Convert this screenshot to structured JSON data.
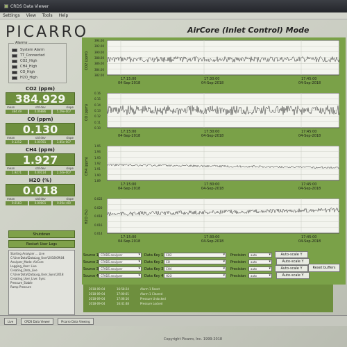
{
  "window": {
    "title": "CRDS Data Viewer"
  },
  "menu": [
    "Settings",
    "View",
    "Tools",
    "Help"
  ],
  "brand": "PICARRO",
  "mode_title": "AirCore (Inlet Control) Mode",
  "alarms": {
    "label": "Alarms",
    "items": [
      "System Alarm",
      "TT_Connected",
      "CO2_High",
      "CH4_High",
      "CO_High",
      "H2O_High"
    ]
  },
  "readouts": [
    {
      "label": "CO2 (ppm)",
      "value": "384.929",
      "stats": [
        "mean",
        "std dev",
        "slope"
      ],
      "statvals": [
        "384.49",
        "0.06886",
        "5.29e-007"
      ]
    },
    {
      "label": "CO (ppm)",
      "value": "0.130",
      "stats": [
        "mean",
        "std dev",
        "slope"
      ],
      "statvals": [
        "0.1252",
        "0.00781",
        "3.85e-007"
      ]
    },
    {
      "label": "CH4 (ppm)",
      "value": "1.927",
      "stats": [
        "mean",
        "std dev",
        "slope"
      ],
      "statvals": [
        "1.9271",
        "0.00114",
        "2.24e-007"
      ]
    },
    {
      "label": "H2O (%)",
      "value": "0.018",
      "stats": [
        "mean",
        "std dev",
        "slope"
      ],
      "statvals": [
        "0.0183",
        "0.00001",
        "0.00e+00"
      ]
    }
  ],
  "buttons": {
    "shutdown": "Shutdown",
    "restart": "Restart User Logs",
    "reset": "Reset buffers",
    "autoscale": "Auto-scale Y"
  },
  "log_lines": [
    "Starting Analyzer ... Live",
    "C:\\UserData\\DataLog_User\\2018\\09\\04",
    "Analyzer_Mode: AirCore",
    "Logging_User: Live",
    "Creating_Data_Live",
    "C:\\UserData\\DataLog_User_Sync\\2018",
    "Creating_User_Live: Sync",
    "Pressure_Stable",
    "Ramp Pressure"
  ],
  "plots": [
    {
      "ylabel": "CO2 (ppm)",
      "yticks": [
        "394.00",
        "392.00",
        "390.00",
        "388.00",
        "386.00",
        "384.00",
        "382.00"
      ],
      "xticks": [
        {
          "t": "17:15:00",
          "d": "04-Sep-2018"
        },
        {
          "t": "17:30:00",
          "d": "04-Sep-2018"
        },
        {
          "t": "17:45:00",
          "d": "04-Sep-2018"
        }
      ]
    },
    {
      "ylabel": "CO (ppm)",
      "yticks": [
        "0.16",
        "0.15",
        "0.14",
        "0.13",
        "0.12",
        "0.11",
        "0.10"
      ],
      "xticks": [
        {
          "t": "17:15:00",
          "d": "04-Sep-2018"
        },
        {
          "t": "17:30:00",
          "d": "04-Sep-2018"
        },
        {
          "t": "17:45:00",
          "d": "04-Sep-2018"
        }
      ]
    },
    {
      "ylabel": "CH4 (ppm)",
      "yticks": [
        "1.95",
        "1.94",
        "1.93",
        "1.92",
        "1.91",
        "1.90",
        "1.89"
      ],
      "xticks": [
        {
          "t": "17:15:00",
          "d": "04-Sep-2018"
        },
        {
          "t": "17:30:00",
          "d": "04-Sep-2018"
        },
        {
          "t": "17:45:00",
          "d": "04-Sep-2018"
        }
      ]
    },
    {
      "ylabel": "H2O (%)",
      "yticks": [
        "0.022",
        "0.020",
        "0.018",
        "0.016",
        "0.014"
      ],
      "xticks": [
        {
          "t": "17:15:00",
          "d": "04-Sep-2018"
        },
        {
          "t": "17:30:00",
          "d": "04-Sep-2018"
        },
        {
          "t": "17:45:00",
          "d": "04-Sep-2018"
        }
      ]
    }
  ],
  "controls": [
    {
      "source": "Source 1",
      "analyzer": "CFADS analyzer",
      "datakey": "Data Key 1",
      "key": "CO2",
      "precision": "Precision",
      "prec": "auto"
    },
    {
      "source": "Source 2",
      "analyzer": "CFADS analyzer",
      "datakey": "Data Key 2",
      "key": "CO",
      "precision": "Precision",
      "prec": "auto"
    },
    {
      "source": "Source 3",
      "analyzer": "CFADS analyzer",
      "datakey": "Data Key 3",
      "key": "CH4",
      "precision": "Precision",
      "prec": "auto"
    },
    {
      "source": "Source 4",
      "analyzer": "CFADS analyzer",
      "datakey": "Data Key 4",
      "key": "H2O",
      "precision": "Precision",
      "prec": "auto"
    }
  ],
  "events": [
    {
      "date": "2018-09-04",
      "time": "16:58:24",
      "msg": "Alarm 1 Reset"
    },
    {
      "date": "2018-09-04",
      "time": "17:00:01",
      "msg": "Alarm 1 Cleared"
    },
    {
      "date": "2018-09-04",
      "time": "17:06:16",
      "msg": "Pressure Unlocked"
    },
    {
      "date": "2018-09-04",
      "time": "16:41:48",
      "msg": "Pressure Locked"
    }
  ],
  "taskbar": [
    "Live",
    "CRDS Data Viewer",
    "Picarro Data Viewing"
  ],
  "copyright": "Copyright Picarro, Inc. 1999-2018",
  "colors": {
    "panel_green": "#7aa148",
    "readout_green": "#6e8f3e",
    "trace": "#2f2f2f"
  }
}
